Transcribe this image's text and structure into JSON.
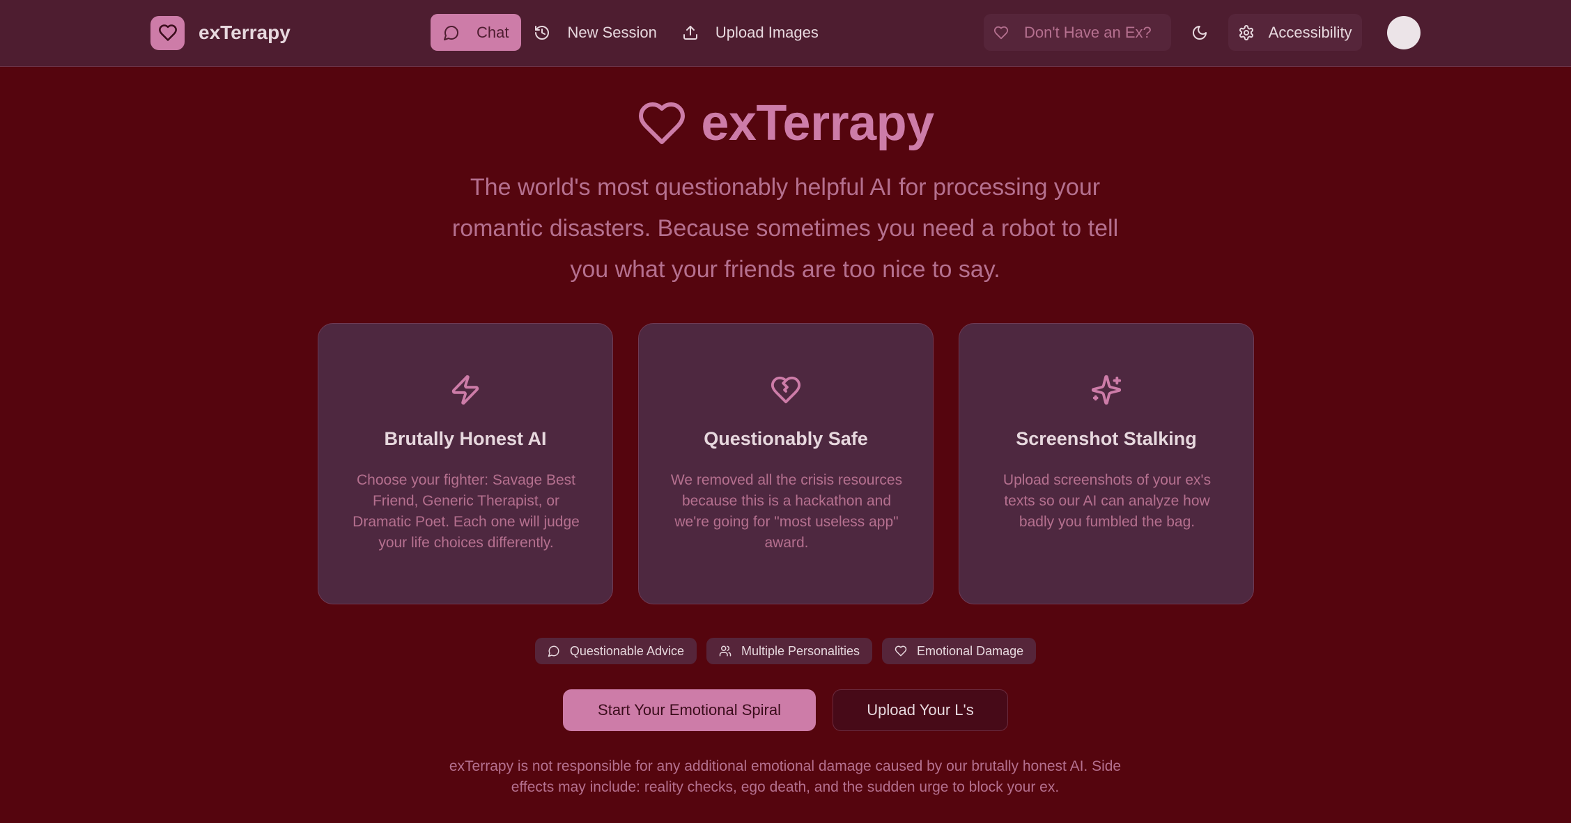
{
  "nav": {
    "brand": "exTerrapy",
    "items": [
      {
        "label": "Chat",
        "icon": "chat-bubble-icon",
        "active": true
      },
      {
        "label": "New Session",
        "icon": "history-icon",
        "active": false
      },
      {
        "label": "Upload Images",
        "icon": "upload-icon",
        "active": false
      }
    ],
    "no_ex_label": "Don't Have an Ex?",
    "accessibility_label": "Accessibility"
  },
  "hero": {
    "title": "exTerrapy",
    "subtitle": "The world's most questionably helpful AI for processing your romantic disasters. Because sometimes you need a robot to tell you what your friends are too nice to say."
  },
  "cards": [
    {
      "icon": "lightning-icon",
      "title": "Brutally Honest AI",
      "text": "Choose your fighter: Savage Best Friend, Generic Therapist, or Dramatic Poet. Each one will judge your life choices differently."
    },
    {
      "icon": "broken-heart-icon",
      "title": "Questionably Safe",
      "text": "We removed all the crisis resources because this is a hackathon and we're going for \"most useless app\" award."
    },
    {
      "icon": "sparkles-icon",
      "title": "Screenshot Stalking",
      "text": "Upload screenshots of your ex's texts so our AI can analyze how badly you fumbled the bag."
    }
  ],
  "tags": [
    {
      "label": "Questionable Advice",
      "icon": "chat-bubble-icon"
    },
    {
      "label": "Multiple Personalities",
      "icon": "users-icon"
    },
    {
      "label": "Emotional Damage",
      "icon": "heart-icon"
    }
  ],
  "cta": {
    "primary": "Start Your Emotional Spiral",
    "secondary": "Upload Your L's"
  },
  "disclaimer": "exTerrapy is not responsible for any additional emotional damage caused by our brutally honest AI. Side effects may include: reality checks, ego death, and the sudden urge to block your ex.",
  "colors": {
    "background": "#55050e",
    "navbar": "#4e1d30",
    "accent": "#cd7ca8",
    "card": "#4e2840",
    "muted_text": "#b5708f"
  }
}
